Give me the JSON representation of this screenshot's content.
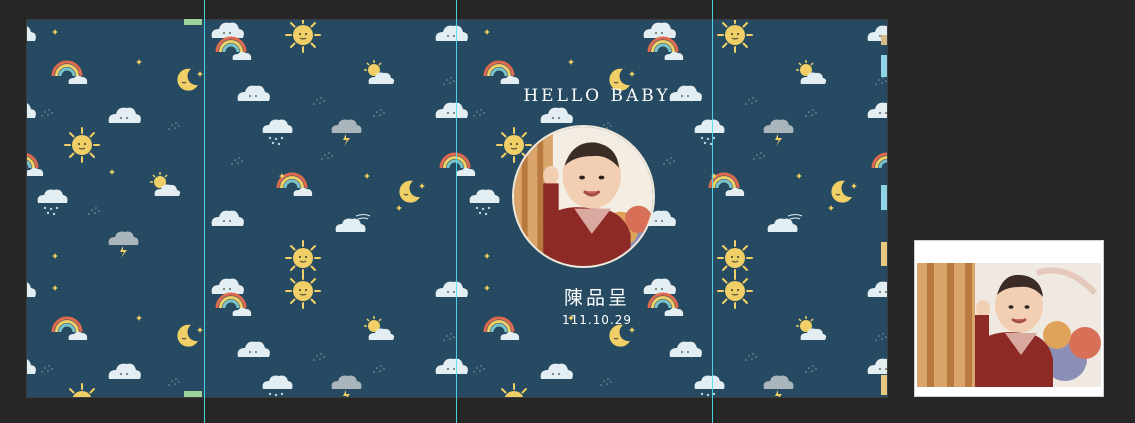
{
  "canvas": {
    "background": "#264a61",
    "title": "HELLO BABY",
    "name": "陳品呈",
    "date": "111.10.29",
    "photo": "baby-portrait"
  },
  "pattern": {
    "motifs": [
      "sun-icon",
      "moon-icon",
      "cloud-icon",
      "rainbow-cloud-icon",
      "rain-cloud-icon",
      "thunder-cloud-icon",
      "star-icon"
    ]
  },
  "preview": {
    "photo": "baby-portrait"
  },
  "colors": {
    "workspace": "#262626",
    "canvas": "#264a61",
    "guide": "#4fe3ee",
    "sun": "#f0cf66",
    "cloud": "#e3eef2"
  }
}
